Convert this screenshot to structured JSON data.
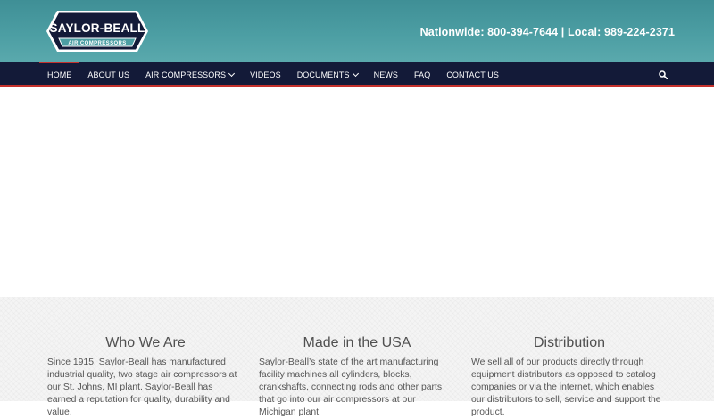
{
  "brand": {
    "name": "SAYLOR-BEALL",
    "tagline": "AIR COMPRESSORS",
    "colors": {
      "navy": "#131a38",
      "teal": "#4c9ea3",
      "red": "#c5312c"
    }
  },
  "header": {
    "phone": "Nationwide: 800-394-7644 | Local: 989-224-2371"
  },
  "nav": {
    "items": [
      {
        "label": "HOME",
        "dropdown": false,
        "active": true
      },
      {
        "label": "ABOUT US",
        "dropdown": false,
        "active": false
      },
      {
        "label": "AIR COMPRESSORS",
        "dropdown": true,
        "active": false
      },
      {
        "label": "VIDEOS",
        "dropdown": false,
        "active": false
      },
      {
        "label": "DOCUMENTS",
        "dropdown": true,
        "active": false
      },
      {
        "label": "NEWS",
        "dropdown": false,
        "active": false
      },
      {
        "label": "FAQ",
        "dropdown": false,
        "active": false
      },
      {
        "label": "CONTACT US",
        "dropdown": false,
        "active": false
      }
    ],
    "search_icon": "search-icon"
  },
  "features": [
    {
      "title": "Who We Are",
      "text": "Since 1915, Saylor-Beall has manufactured industrial quality, two stage air compressors at our St. Johns, MI plant.  Saylor-Beall has earned a reputation for quality, durability and value."
    },
    {
      "title": "Made in the USA",
      "text": "Saylor-Beall’s state of the art manufacturing facility machines all cylinders, blocks, crankshafts, connecting rods and other parts that go into our air compressors at our Michigan plant."
    },
    {
      "title": "Distribution",
      "text": "We sell all of our products directly through equipment distributors as opposed to catalog companies or via the internet, which enables our distributors to sell, service and support the product."
    }
  ]
}
